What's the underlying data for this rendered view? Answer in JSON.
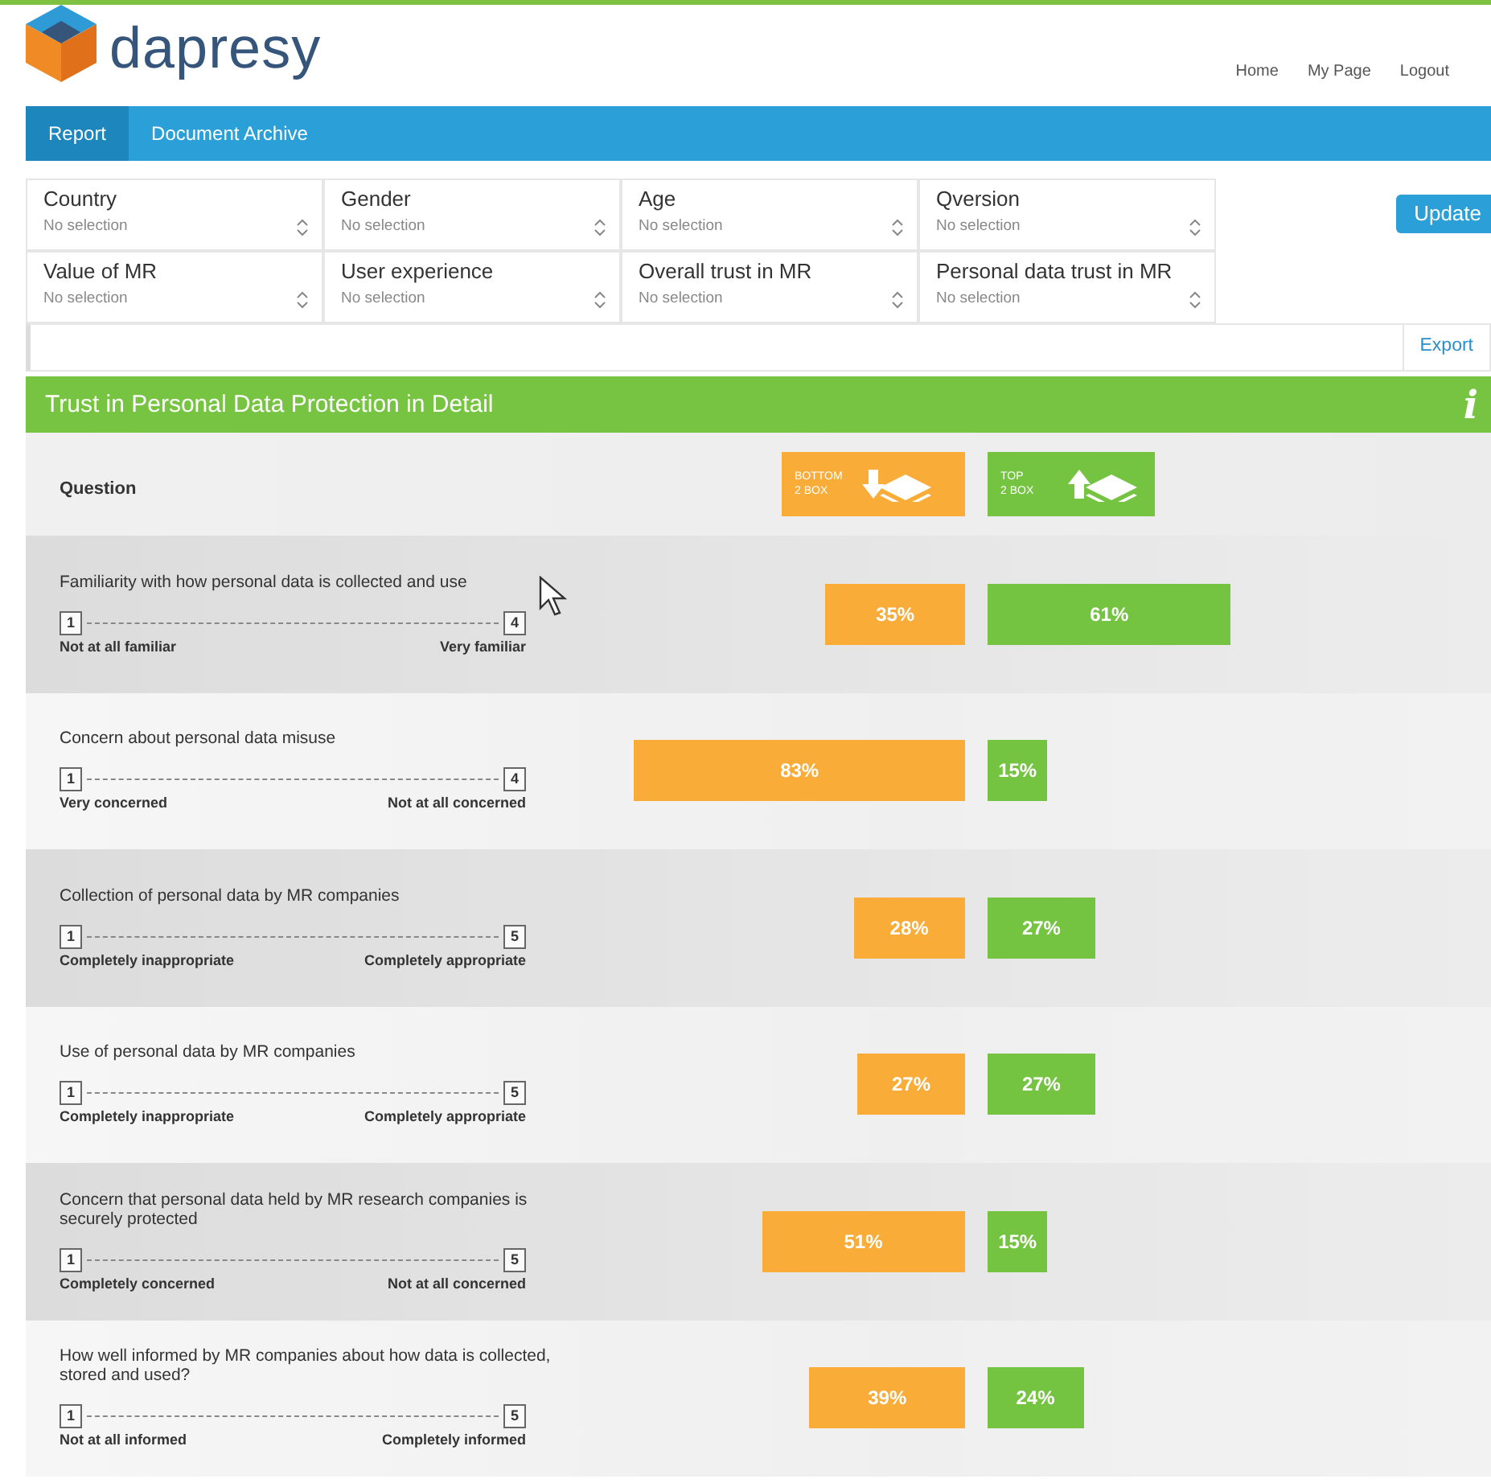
{
  "logo": {
    "text": "dapresy"
  },
  "top_links": [
    "Home",
    "My Page",
    "Logout"
  ],
  "tabs": [
    {
      "label": "Report",
      "selected": true
    },
    {
      "label": "Document Archive",
      "selected": false
    }
  ],
  "filters": [
    {
      "label": "Country",
      "value": "No selection"
    },
    {
      "label": "Gender",
      "value": "No selection"
    },
    {
      "label": "Age",
      "value": "No selection"
    },
    {
      "label": "Qversion",
      "value": "No selection"
    },
    {
      "label": "Value of MR",
      "value": "No selection"
    },
    {
      "label": "User experience",
      "value": "No selection"
    },
    {
      "label": "Overall trust in MR",
      "value": "No selection"
    },
    {
      "label": "Personal data trust in MR",
      "value": "No selection"
    }
  ],
  "update_button": "Update",
  "export_link": "Export",
  "panel": {
    "title": "Trust in Personal Data Protection in Detail",
    "info": "i",
    "question_header": "Question",
    "legend": [
      {
        "kind": "bottom",
        "line1": "BOTTOM",
        "line2": "2 BOX"
      },
      {
        "kind": "top",
        "line1": "TOP",
        "line2": "2 BOX"
      }
    ],
    "questions": [
      {
        "text": "Familiarity with how personal data is collected and use",
        "scale_min": "1",
        "scale_max": "4",
        "min_label": "Not at all familiar",
        "max_label": "Very familiar",
        "bottom": {
          "reading": "35%"
        },
        "top": {
          "reading": "61%"
        }
      },
      {
        "text": "Concern about personal data misuse",
        "scale_min": "1",
        "scale_max": "4",
        "min_label": "Very concerned",
        "max_label": "Not at all concerned",
        "bottom": {
          "reading": "83%"
        },
        "top": {
          "reading": "15%"
        }
      },
      {
        "text": "Collection of personal data by MR companies",
        "scale_min": "1",
        "scale_max": "5",
        "min_label": "Completely inappropriate",
        "max_label": "Completely appropriate",
        "bottom": {
          "reading": "28%"
        },
        "top": {
          "reading": "27%"
        }
      },
      {
        "text": "Use of personal data by MR companies",
        "scale_min": "1",
        "scale_max": "5",
        "min_label": "Completely inappropriate",
        "max_label": "Completely appropriate",
        "bottom": {
          "reading": "27%"
        },
        "top": {
          "reading": "27%"
        }
      },
      {
        "text": "Concern that personal data held by MR research companies is securely protected",
        "scale_min": "1",
        "scale_max": "5",
        "min_label": "Completely concerned",
        "max_label": "Not at all concerned",
        "bottom": {
          "reading": "51%"
        },
        "top": {
          "reading": "15%"
        }
      },
      {
        "text": "How well informed by MR companies about how data is collected, stored and used?",
        "scale_min": "1",
        "scale_max": "5",
        "min_label": "Not at all informed",
        "max_label": "Completely informed",
        "bottom": {
          "reading": "39%"
        },
        "top": {
          "reading": "24%"
        }
      }
    ]
  }
}
